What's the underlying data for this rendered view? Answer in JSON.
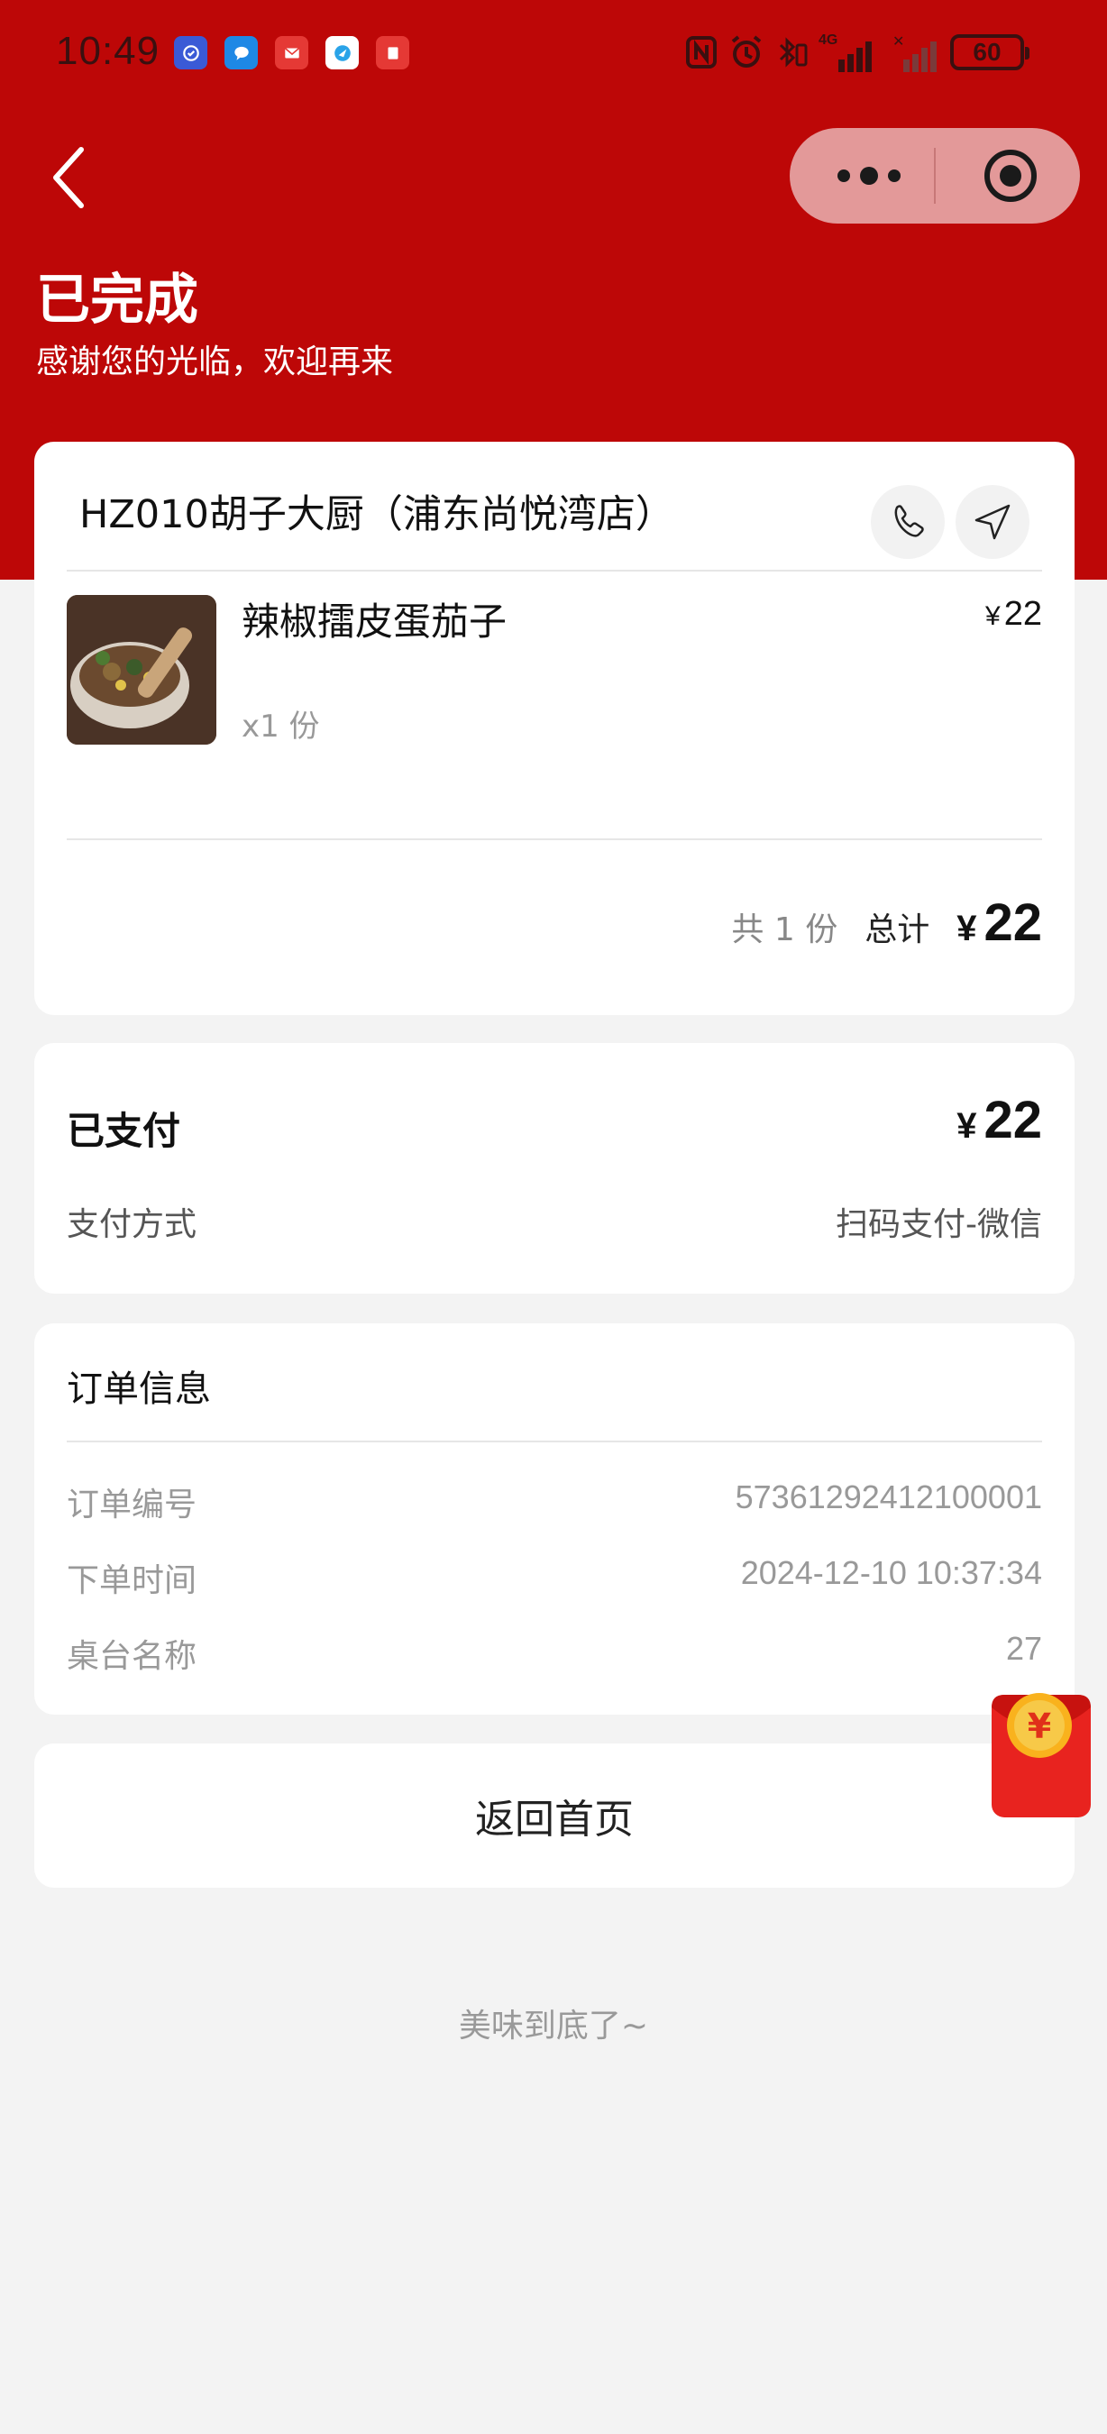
{
  "status_bar": {
    "time": "10:49",
    "network": "4G",
    "battery": "60"
  },
  "header": {
    "title": "已完成",
    "subtitle": "感谢您的光临，欢迎再来"
  },
  "order": {
    "store_name": "HZ010胡子大厨（浦东尚悦湾店）",
    "items": [
      {
        "name": "辣椒擂皮蛋茄子",
        "quantity": "x1 份",
        "price": "22",
        "currency": "¥"
      }
    ],
    "summary": {
      "count": "共 1 份",
      "total_label": "总计",
      "currency": "¥",
      "total": "22"
    }
  },
  "payment": {
    "status": "已支付",
    "currency": "¥",
    "amount": "22",
    "method_label": "支付方式",
    "method_value": "扫码支付-微信"
  },
  "order_info": {
    "title": "订单信息",
    "rows": [
      {
        "label": "订单编号",
        "value": "57361292412100001"
      },
      {
        "label": "下单时间",
        "value": "2024-12-10 10:37:34"
      },
      {
        "label": "桌台名称",
        "value": "27"
      }
    ]
  },
  "home_button": "返回首页",
  "footer": "美味到底了~",
  "colors": {
    "brand_red": "#bd0707",
    "capsule": "#e39999",
    "background": "#f3f3f3"
  }
}
